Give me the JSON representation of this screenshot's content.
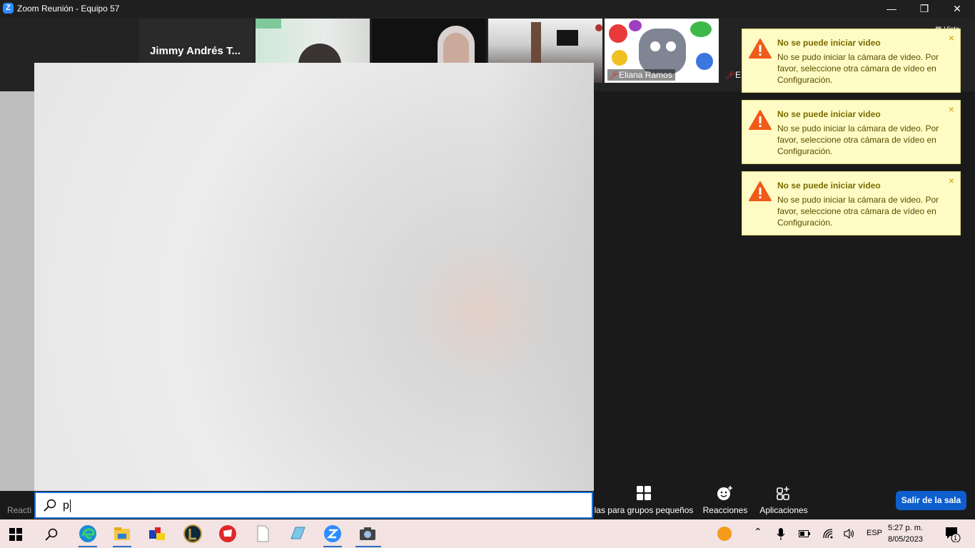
{
  "window": {
    "title": "Zoom Reunión - Equipo 57",
    "logo_letter": "Z",
    "minimize": "—",
    "maximize": "❐",
    "close": "✕"
  },
  "participants": {
    "name_tile": "Jimmy Andrés T...",
    "tile_named": "Eliana Ramos",
    "tile_partial": "E"
  },
  "view_label": "Vista",
  "search": {
    "value": "p"
  },
  "toasts": [
    {
      "title": "No se puede iniciar video",
      "body": "No se pudo iniciar la cámara de video. Por favor, seleccione otra cámara de vídeo en Configuración.",
      "close": "×"
    },
    {
      "title": "No se puede iniciar video",
      "body": "No se pudo iniciar la cámara de video. Por favor, seleccione otra cámara de vídeo en Configuración.",
      "close": "×"
    },
    {
      "title": "No se puede iniciar video",
      "body": "No se pudo iniciar la cámara de video. Por favor, seleccione otra cámara de vídeo en Configuración.",
      "close": "×"
    }
  ],
  "toolbar": {
    "reactions_left_partial": "Reacti",
    "breakout": "las para grupos pequeños",
    "reactions": "Reacciones",
    "apps": "Aplicaciones",
    "leave": "Salir de la sala"
  },
  "taskbar": {
    "language": "ESP",
    "time": "5:27 p. m.",
    "date": "8/05/2023",
    "notification_count": "1",
    "icons": [
      "windows-start-icon",
      "search-icon",
      "edge-icon",
      "file-explorer-icon",
      "office-app-icon",
      "league-of-legends-icon",
      "riot-client-icon",
      "document-icon",
      "notepad-icon",
      "zoom-icon",
      "camera-icon"
    ]
  },
  "colors": {
    "toast_bg": "#fefcc4",
    "warn": "#f05a1a",
    "leave_button": "#0e5ecd",
    "taskbar": "#f3e3e3"
  }
}
